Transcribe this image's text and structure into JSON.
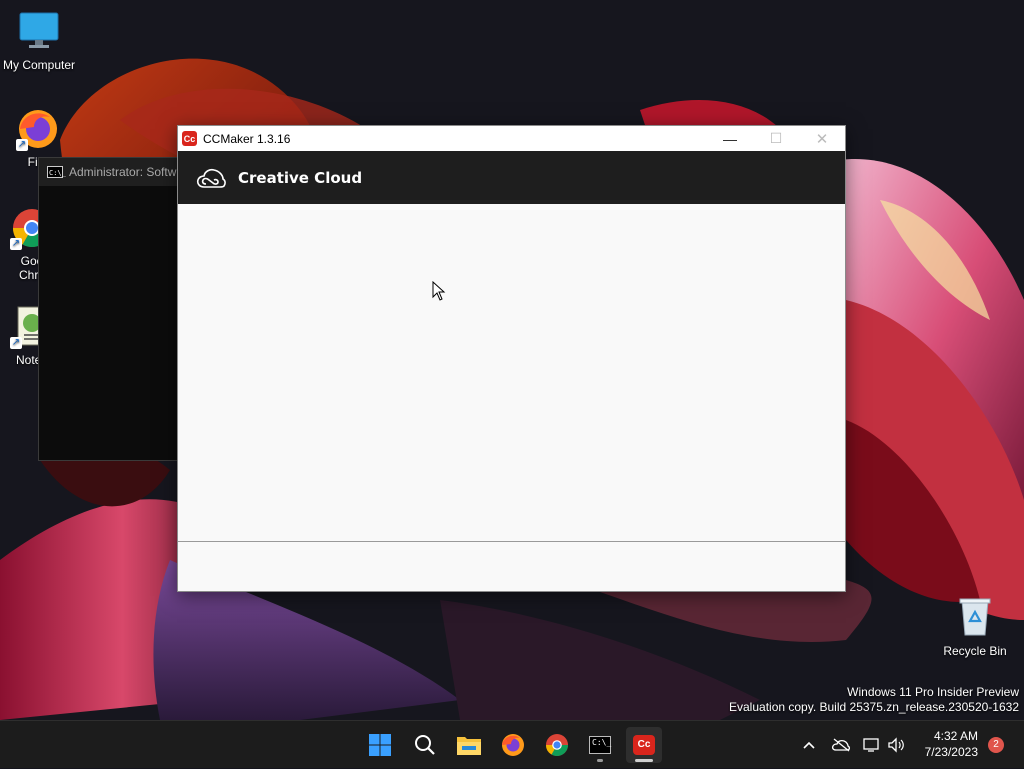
{
  "desktop": {
    "icons": [
      {
        "label": "My Computer",
        "icon": "monitor-icon"
      },
      {
        "label": "Fire",
        "icon": "firefox-icon"
      },
      {
        "label": "Goo",
        "label2": "Chro",
        "icon": "chrome-icon"
      },
      {
        "label": "Notep",
        "icon": "notepad-icon"
      }
    ],
    "recycle_bin": {
      "label": "Recycle Bin",
      "icon": "recycle-bin-icon"
    },
    "watermark": {
      "line1": "Windows 11 Pro Insider Preview",
      "line2": "Evaluation copy. Build 25375.zn_release.230520-1632"
    }
  },
  "cmd_window": {
    "title": "Administrator:  Softw",
    "icon": "cmd-icon",
    "icon_text": "C:\\_"
  },
  "ccmaker_window": {
    "title": "CCMaker 1.3.16",
    "app_icon_text": "Cc",
    "header_title": "Creative Cloud",
    "controls": {
      "minimize": "—",
      "maximize": "☐",
      "close": "✕"
    },
    "accent": "#d9251c",
    "header_bg": "#1e1e1e"
  },
  "taskbar": {
    "apps": [
      {
        "name": "start",
        "icon": "windows-start-icon"
      },
      {
        "name": "search",
        "icon": "search-icon"
      },
      {
        "name": "file-explorer",
        "icon": "folder-icon"
      },
      {
        "name": "firefox",
        "icon": "firefox-icon"
      },
      {
        "name": "chrome",
        "icon": "chrome-icon"
      },
      {
        "name": "terminal",
        "icon": "cmd-icon",
        "icon_text": "C:\\_"
      },
      {
        "name": "ccmaker",
        "icon": "ccmaker-icon",
        "icon_text": "Cc"
      }
    ],
    "tray": {
      "chevron": "^",
      "icons": [
        "cloud-offline-icon",
        "network-icon",
        "volume-icon"
      ]
    },
    "clock": {
      "time": "4:32 AM",
      "date": "7/23/2023"
    },
    "notifications": "2"
  }
}
